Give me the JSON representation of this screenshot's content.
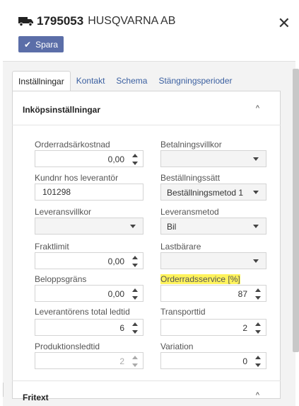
{
  "header": {
    "id": "1795053",
    "name": "HUSQVARNA AB",
    "save_label": "Spara",
    "close_glyph": "✕"
  },
  "tabs": [
    {
      "label": "Inställningar",
      "active": true
    },
    {
      "label": "Kontakt"
    },
    {
      "label": "Schema"
    },
    {
      "label": "Stängningsperioder"
    }
  ],
  "section": {
    "title": "Inköpsinställningar",
    "chevron": "^"
  },
  "fields": {
    "orderradsarkostnad": {
      "label": "Orderradsärkostnad",
      "value": "0,00"
    },
    "betalningsvillkor": {
      "label": "Betalningsvillkor",
      "value": ""
    },
    "kundnr": {
      "label": "Kundnr hos leverantör",
      "value": "101298"
    },
    "bestallningssatt": {
      "label": "Beställningssätt",
      "value": "Beställningsmetod 1"
    },
    "leveransvillkor": {
      "label": "Leveransvillkor",
      "value": ""
    },
    "leveransmetod": {
      "label": "Leveransmetod",
      "value": "Bil"
    },
    "fraktlimit": {
      "label": "Fraktlimit",
      "value": "0,00"
    },
    "lastbarare": {
      "label": "Lastbärare",
      "value": ""
    },
    "beloppsgrans": {
      "label": "Beloppsgräns",
      "value": "0,00"
    },
    "orderradsservice": {
      "label": "Orderradsservice [%]",
      "value": "87"
    },
    "ledtid": {
      "label": "Leverantörens total ledtid",
      "value": "6"
    },
    "transporttid": {
      "label": "Transporttid",
      "value": "2"
    },
    "produktionsledtid": {
      "label": "Produktionsledtid",
      "value": "2"
    },
    "variation": {
      "label": "Variation",
      "value": "0"
    }
  },
  "fritext": {
    "title": "Fritext",
    "chevron": "^"
  },
  "colors": {
    "accent": "#5b6ea8",
    "highlight": "#fff35c",
    "tab_link": "#3a5fa0"
  }
}
